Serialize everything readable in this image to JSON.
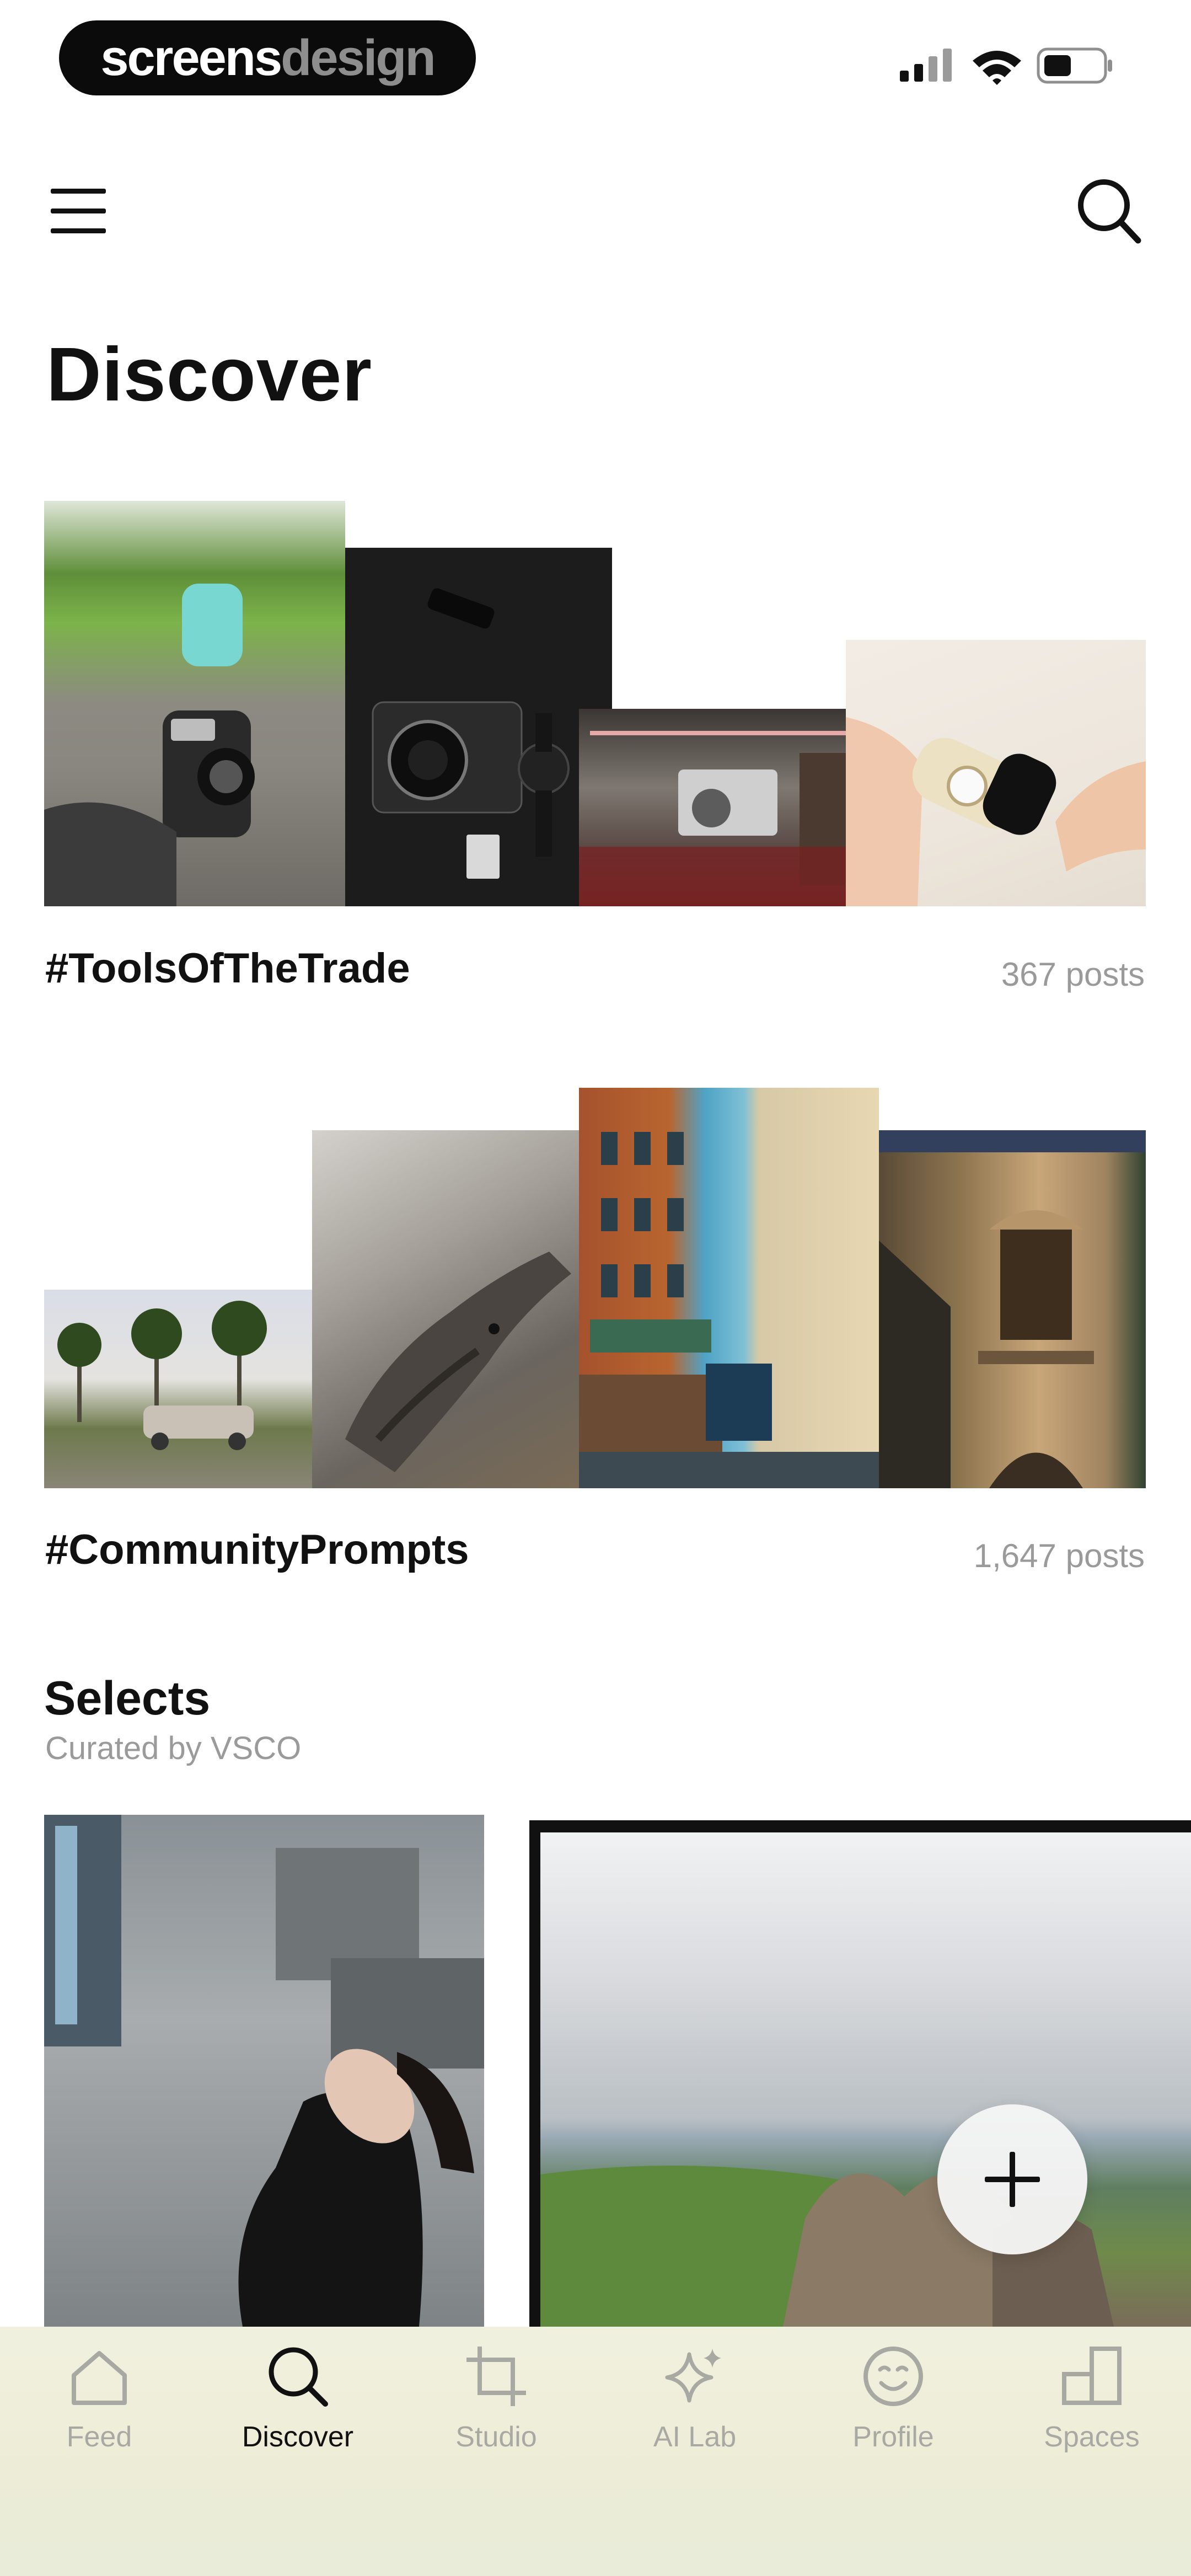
{
  "status_bar": {
    "brand_part1": "screens",
    "brand_part2": "design",
    "icons": [
      "signal-icon",
      "wifi-icon",
      "battery-icon"
    ]
  },
  "header": {
    "icons": [
      "menu-icon",
      "search-icon"
    ],
    "title": "Discover"
  },
  "tags": [
    {
      "tag": "#ToolsOfTheTrade",
      "count": "367 posts"
    },
    {
      "tag": "#CommunityPrompts",
      "count": "1,647 posts"
    }
  ],
  "selects": {
    "title": "Selects",
    "subtitle": "Curated by VSCO"
  },
  "fab": {
    "icon": "plus-icon"
  },
  "bottom_nav": {
    "active": "Discover",
    "items": [
      {
        "label": "Feed",
        "icon": "home-icon"
      },
      {
        "label": "Discover",
        "icon": "search-icon"
      },
      {
        "label": "Studio",
        "icon": "crop-icon"
      },
      {
        "label": "AI Lab",
        "icon": "sparkle-icon"
      },
      {
        "label": "Profile",
        "icon": "smiley-icon"
      },
      {
        "label": "Spaces",
        "icon": "spaces-icon"
      }
    ]
  },
  "colors": {
    "text_primary": "#111111",
    "text_secondary": "#9a9a9a",
    "nav_inactive": "#a9a9a3",
    "nav_background": "#ececd6"
  }
}
